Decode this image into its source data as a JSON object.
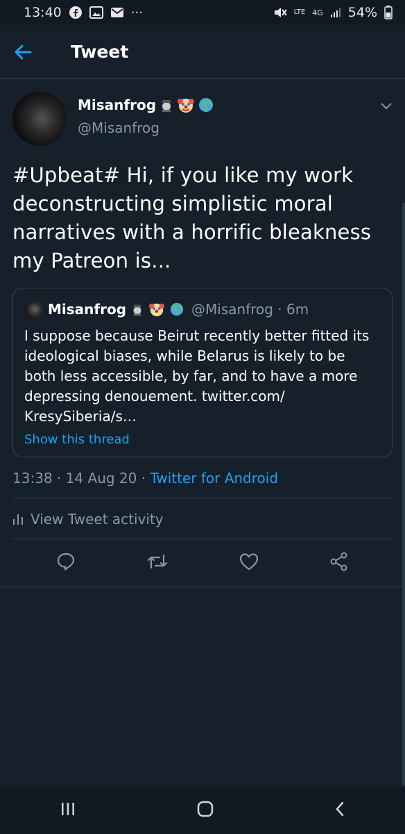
{
  "status_bar": {
    "time": "13:40",
    "battery": "54%",
    "network": "4G",
    "lte_label": "LTE"
  },
  "app_bar": {
    "title": "Tweet"
  },
  "tweet": {
    "author_name": "Misanfrog",
    "author_handle": "@Misanfrog",
    "text": "#Upbeat# Hi, if you like my work deconstructing simplistic moral narratives with a horrific bleakness my Patreon is...",
    "timestamp": "13:38 · 14 Aug 20 · ",
    "source": "Twitter for Android"
  },
  "quoted_tweet": {
    "author_name": "Misanfrog",
    "meta": "@Misanfrog · 6m",
    "text": "I suppose because Beirut recently better fitted its ideological biases, while Belarus is likely to be both less accessible, by far, and to have a more depressing denouement. twitter.com/ KresySiberia/s…",
    "show_thread": "Show this thread"
  },
  "activity": {
    "label": "View Tweet activity"
  },
  "colors": {
    "background": "#15202b",
    "accent": "#1da1f2",
    "muted": "#8899a6",
    "border": "#38444d"
  }
}
